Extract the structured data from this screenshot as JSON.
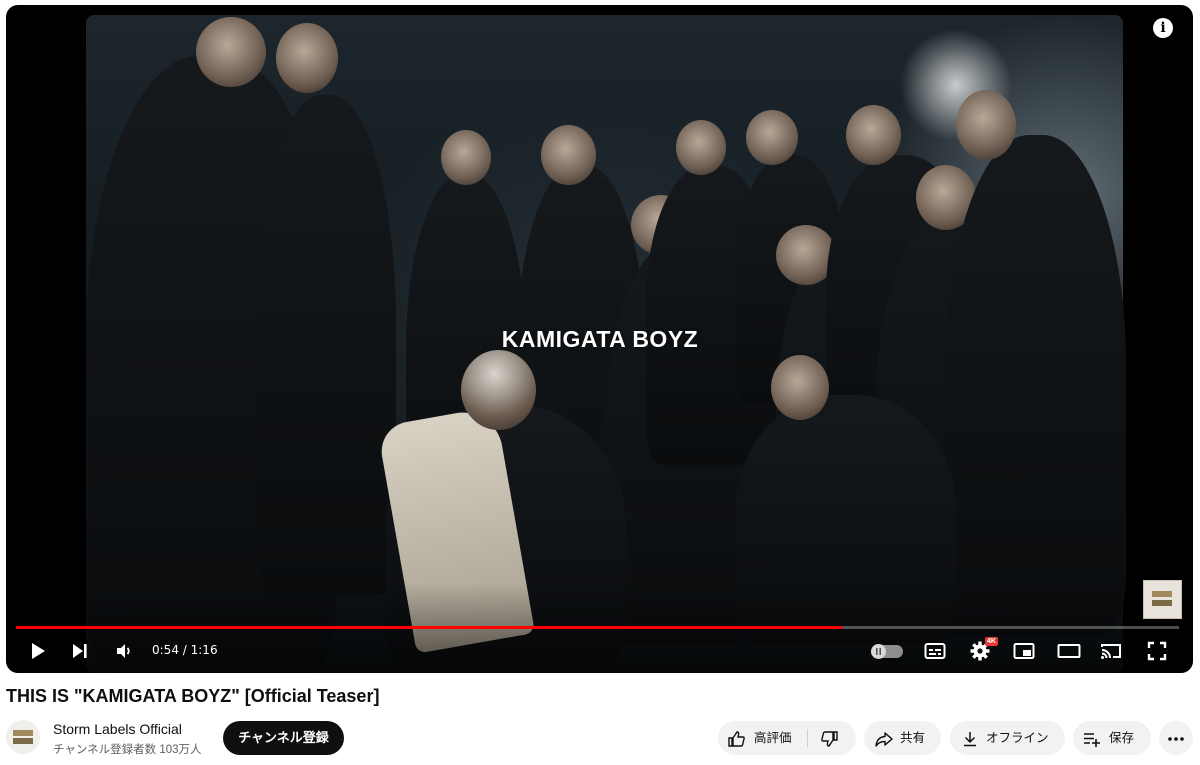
{
  "player": {
    "overlay_title": "KAMIGATA BOYZ",
    "time_current": "0:54",
    "time_separator": " / ",
    "time_total": "1:16",
    "progress_fraction": 0.71,
    "quality_badge": "4K",
    "controls": [
      "play-icon",
      "next-icon",
      "volume-icon",
      "autoplay-toggle",
      "subtitles-icon",
      "settings-icon",
      "miniplayer-icon",
      "theater-icon",
      "cast-icon",
      "fullscreen-icon"
    ],
    "info_glyph": "i",
    "accent_color": "#ff0000"
  },
  "video": {
    "title": "THIS IS \"KAMIGATA BOYZ\" [Official Teaser]"
  },
  "channel": {
    "name": "Storm Labels Official",
    "subscribers": "チャンネル登録者数 103万人",
    "subscribe_label": "チャンネル登録"
  },
  "actions": {
    "like_label": "高評価",
    "share_label": "共有",
    "offline_label": "オフライン",
    "save_label": "保存"
  }
}
